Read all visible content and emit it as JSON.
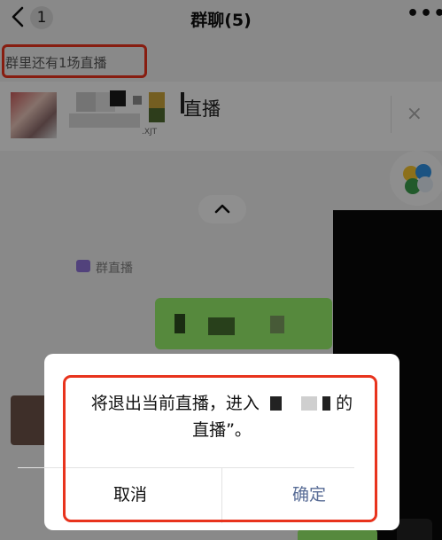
{
  "navbar": {
    "back_count": "1",
    "title": "群聊(5)",
    "more": "•••"
  },
  "banner": {
    "hint": "群里还有1场直播",
    "card_label": "直播",
    "small_tag": ".XJT",
    "close": "×"
  },
  "chat": {
    "group_live_label": "群直播"
  },
  "dialog": {
    "message_line1_a": "将退出当前直播，进入",
    "message_line1_b": "的",
    "message_line2": "直播”。",
    "cancel_label": "取消",
    "confirm_label": "确定"
  },
  "colors": {
    "annotation": "#e8331d",
    "confirm": "#576b95",
    "bubble": "#95ec69"
  }
}
